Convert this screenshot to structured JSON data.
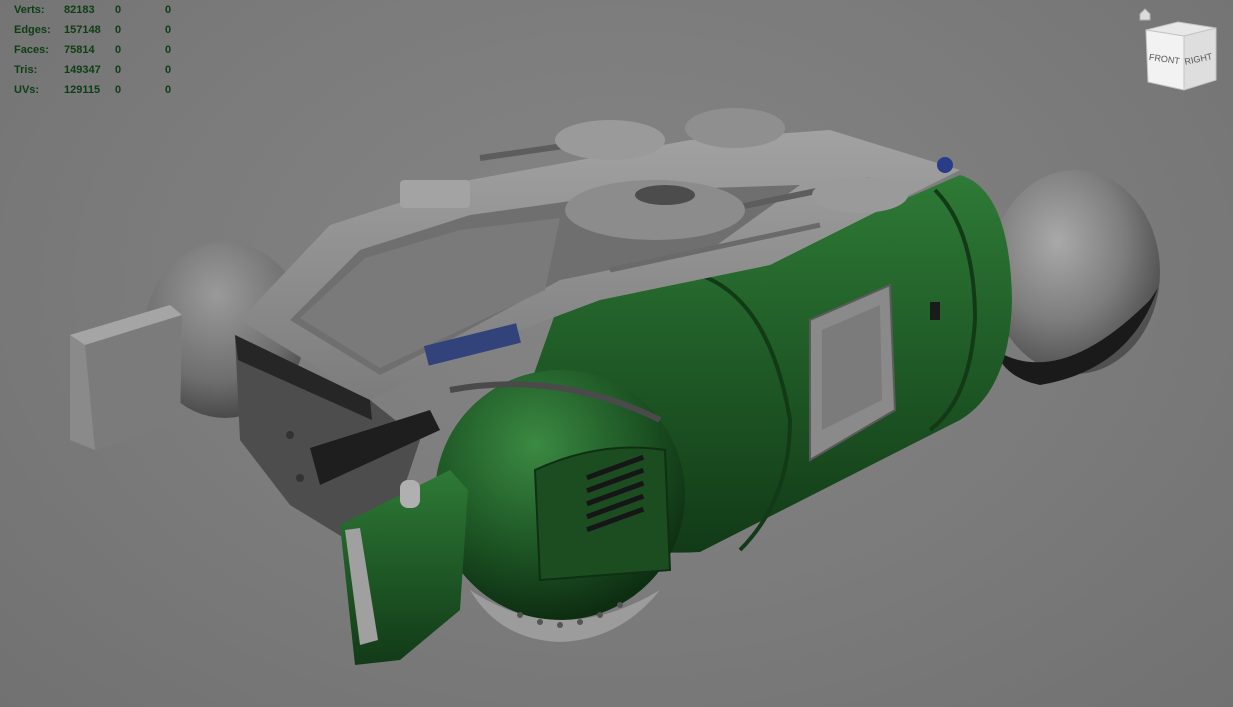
{
  "hud": {
    "rows": [
      {
        "label": "Verts:",
        "v1": "82183",
        "v2": "0",
        "v3": "0"
      },
      {
        "label": "Edges:",
        "v1": "157148",
        "v2": "0",
        "v3": "0"
      },
      {
        "label": "Faces:",
        "v1": "75814",
        "v2": "0",
        "v3": "0"
      },
      {
        "label": "Tris:",
        "v1": "149347",
        "v2": "0",
        "v3": "0"
      },
      {
        "label": "UVs:",
        "v1": "129115",
        "v2": "0",
        "v3": "0"
      }
    ]
  },
  "viewcube": {
    "front_label": "FRONT",
    "right_label": "RIGHT"
  },
  "colors": {
    "hud_text": "#0e3d14",
    "background": "#7a7a7a",
    "hull_green": "#1f5a26",
    "hull_grey": "#8e8e8e"
  }
}
